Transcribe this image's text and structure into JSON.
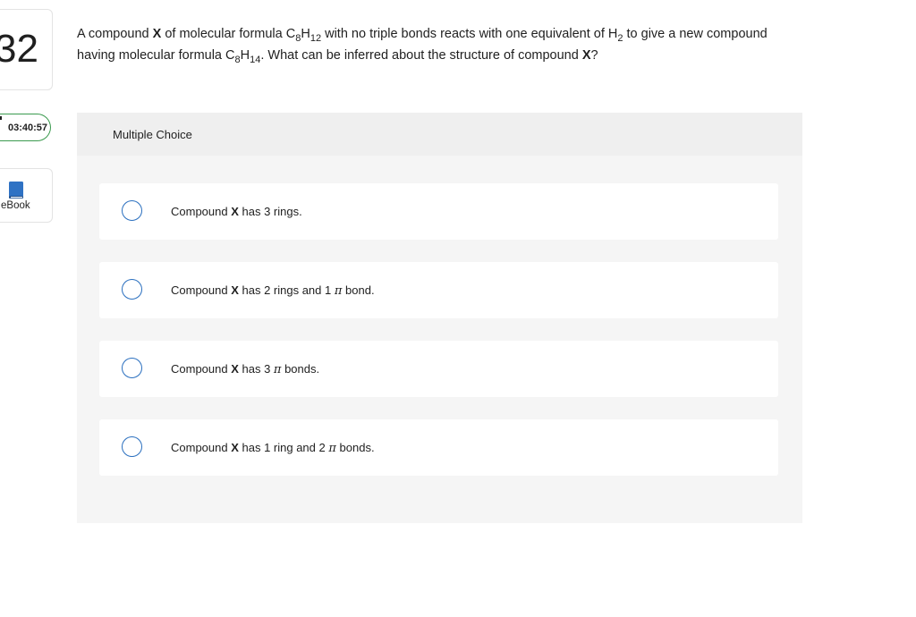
{
  "question_number": "32",
  "timer": "03:40:57",
  "ebook_label": "eBook",
  "question": {
    "p1": "A compound ",
    "x1": "X",
    "p2": " of molecular formula C",
    "s1": "8",
    "p3": "H",
    "s2": "12",
    "p4": " with no triple bonds reacts with one equivalent of H",
    "s3": "2",
    "p5": " to give a new compound having molecular formula C",
    "s4": "8",
    "p6": "H",
    "s5": "14",
    "p7": ". What can be inferred about the structure of compound ",
    "x2": "X",
    "p8": "?"
  },
  "mc_title": "Multiple Choice",
  "options": [
    {
      "pre": "Compound ",
      "x": "X",
      "mid": " has 3 rings.",
      "pi": "",
      "post": ""
    },
    {
      "pre": "Compound ",
      "x": "X",
      "mid": " has 2 rings and 1 ",
      "pi": "π",
      "post": " bond."
    },
    {
      "pre": "Compound ",
      "x": "X",
      "mid": " has 3 ",
      "pi": "π",
      "post": " bonds."
    },
    {
      "pre": "Compound ",
      "x": "X",
      "mid": " has 1 ring and 2 ",
      "pi": "π",
      "post": " bonds."
    }
  ],
  "colors": {
    "radio_border": "#2a6fbf",
    "timer_border": "#3a9a4e",
    "ebook_icon": "#2f72c4"
  },
  "icons": {
    "ebook": "book-icon"
  }
}
